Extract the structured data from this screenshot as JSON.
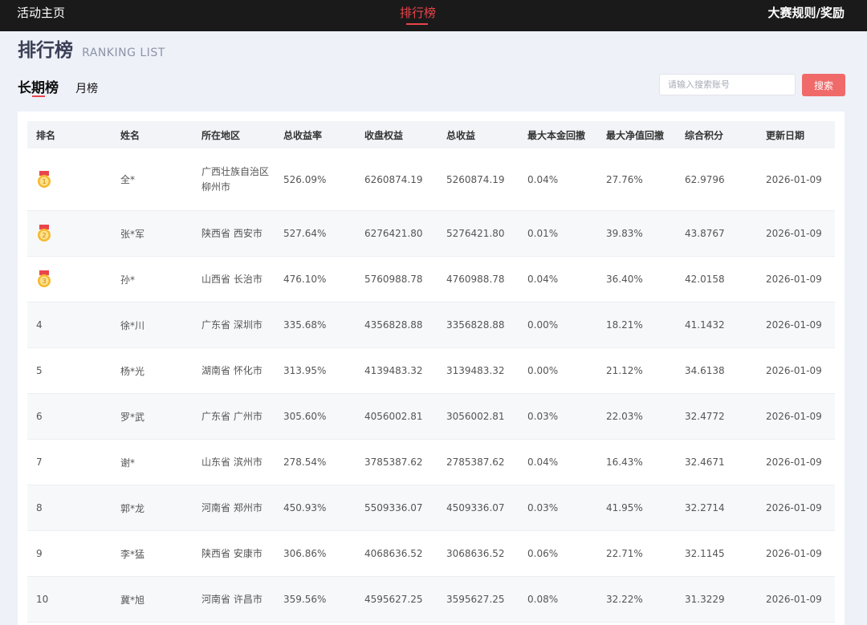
{
  "topnav": {
    "home": "活动主页",
    "ranking": "排行榜",
    "rules": "大赛规则/奖励"
  },
  "page": {
    "title": "排行榜",
    "subtitle": "RANKING LIST"
  },
  "tabs": [
    {
      "label": "长期榜",
      "active": true
    },
    {
      "label": "月榜",
      "active": false
    }
  ],
  "search": {
    "placeholder": "请输入搜索账号",
    "button": "搜索"
  },
  "colors": {
    "accent": "#e9454b",
    "button": "#f06a6a",
    "medal": "#f5b82e"
  },
  "table": {
    "headers": [
      "排名",
      "姓名",
      "所在地区",
      "总收益率",
      "收盘权益",
      "总收益",
      "最大本金回撤",
      "最大净值回撤",
      "综合积分",
      "更新日期"
    ],
    "rows": [
      {
        "rank": "1",
        "medal": "gold-medal-icon",
        "name": "全*",
        "region": "广西壮族自治区 柳州市",
        "yield": "526.09%",
        "equity": "6260874.19",
        "profit": "5260874.19",
        "max_principal_dd": "0.04%",
        "max_nav_dd": "27.76%",
        "score": "62.9796",
        "date": "2026-01-09"
      },
      {
        "rank": "2",
        "medal": "silver-medal-icon",
        "name": "张*军",
        "region": "陕西省 西安市",
        "yield": "527.64%",
        "equity": "6276421.80",
        "profit": "5276421.80",
        "max_principal_dd": "0.01%",
        "max_nav_dd": "39.83%",
        "score": "43.8767",
        "date": "2026-01-09"
      },
      {
        "rank": "3",
        "medal": "bronze-medal-icon",
        "name": "孙*",
        "region": "山西省 长治市",
        "yield": "476.10%",
        "equity": "5760988.78",
        "profit": "4760988.78",
        "max_principal_dd": "0.04%",
        "max_nav_dd": "36.40%",
        "score": "42.0158",
        "date": "2026-01-09"
      },
      {
        "rank": "4",
        "medal": "",
        "name": "徐*川",
        "region": "广东省 深圳市",
        "yield": "335.68%",
        "equity": "4356828.88",
        "profit": "3356828.88",
        "max_principal_dd": "0.00%",
        "max_nav_dd": "18.21%",
        "score": "41.1432",
        "date": "2026-01-09"
      },
      {
        "rank": "5",
        "medal": "",
        "name": "杨*光",
        "region": "湖南省 怀化市",
        "yield": "313.95%",
        "equity": "4139483.32",
        "profit": "3139483.32",
        "max_principal_dd": "0.00%",
        "max_nav_dd": "21.12%",
        "score": "34.6138",
        "date": "2026-01-09"
      },
      {
        "rank": "6",
        "medal": "",
        "name": "罗*武",
        "region": "广东省 广州市",
        "yield": "305.60%",
        "equity": "4056002.81",
        "profit": "3056002.81",
        "max_principal_dd": "0.03%",
        "max_nav_dd": "22.03%",
        "score": "32.4772",
        "date": "2026-01-09"
      },
      {
        "rank": "7",
        "medal": "",
        "name": "谢*",
        "region": "山东省 滨州市",
        "yield": "278.54%",
        "equity": "3785387.62",
        "profit": "2785387.62",
        "max_principal_dd": "0.04%",
        "max_nav_dd": "16.43%",
        "score": "32.4671",
        "date": "2026-01-09"
      },
      {
        "rank": "8",
        "medal": "",
        "name": "郭*龙",
        "region": "河南省 郑州市",
        "yield": "450.93%",
        "equity": "5509336.07",
        "profit": "4509336.07",
        "max_principal_dd": "0.03%",
        "max_nav_dd": "41.95%",
        "score": "32.2714",
        "date": "2026-01-09"
      },
      {
        "rank": "9",
        "medal": "",
        "name": "李*猛",
        "region": "陕西省 安康市",
        "yield": "306.86%",
        "equity": "4068636.52",
        "profit": "3068636.52",
        "max_principal_dd": "0.06%",
        "max_nav_dd": "22.71%",
        "score": "32.1145",
        "date": "2026-01-09"
      },
      {
        "rank": "10",
        "medal": "",
        "name": "冀*旭",
        "region": "河南省 许昌市",
        "yield": "359.56%",
        "equity": "4595627.25",
        "profit": "3595627.25",
        "max_principal_dd": "0.08%",
        "max_nav_dd": "32.22%",
        "score": "31.3229",
        "date": "2026-01-09"
      }
    ]
  }
}
